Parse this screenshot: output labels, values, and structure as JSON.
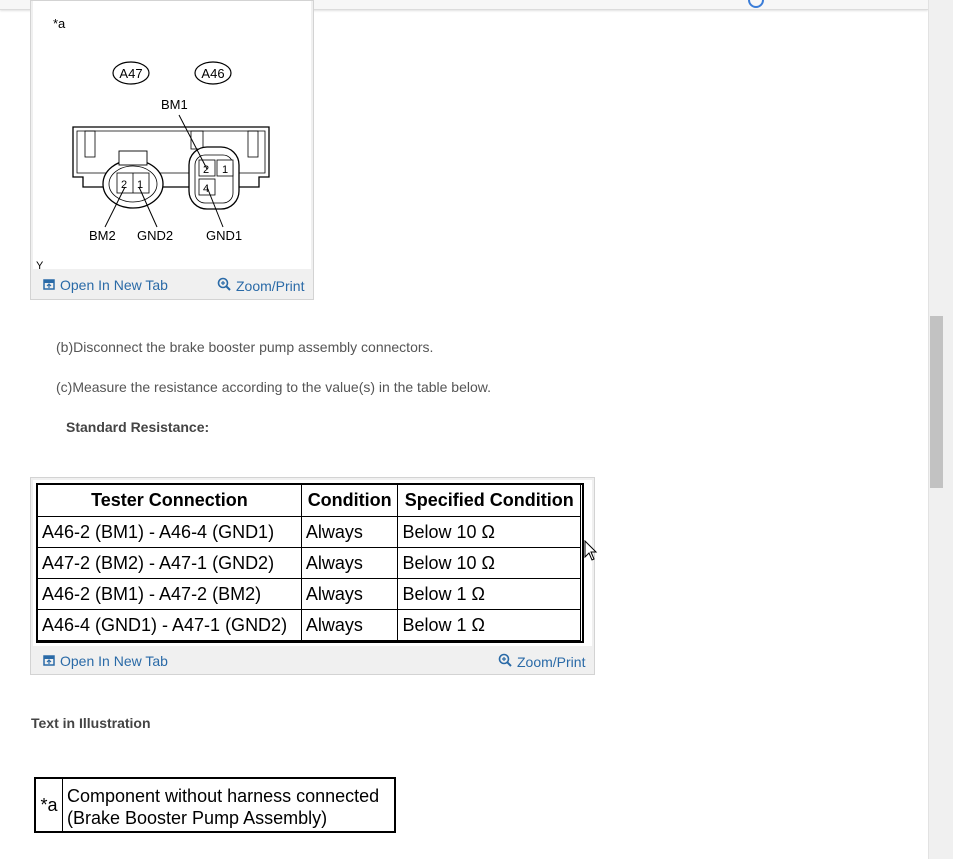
{
  "figure1": {
    "corner_label": "*a",
    "bottom_label": "Y",
    "connectors": {
      "left_id": "A47",
      "right_id": "A46",
      "bm1": "BM1",
      "bm2": "BM2",
      "gnd2": "GND2",
      "gnd1": "GND1",
      "pin_2_left": "2",
      "pin_1_left": "1",
      "pin_2_right": "2",
      "pin_1_right": "1",
      "pin_4_right": "4"
    },
    "open_tab": "Open In New Tab",
    "zoom": "Zoom/Print"
  },
  "steps": {
    "b": "(b)Disconnect the brake booster pump assembly connectors.",
    "c": "(c)Measure the resistance according to the value(s) in the table below.",
    "standard": "Standard Resistance:"
  },
  "table": {
    "headers": [
      "Tester Connection",
      "Condition",
      "Specified Condition"
    ],
    "rows": [
      [
        "A46-2 (BM1) - A46-4 (GND1)",
        "Always",
        "Below 10 Ω"
      ],
      [
        "A47-2 (BM2) - A47-1 (GND2)",
        "Always",
        "Below 10 Ω"
      ],
      [
        "A46-2 (BM1) - A47-2 (BM2)",
        "Always",
        "Below 1 Ω"
      ],
      [
        "A46-4 (GND1) - A47-1 (GND2)",
        "Always",
        "Below 1 Ω"
      ]
    ],
    "open_tab": "Open In New Tab",
    "zoom": "Zoom/Print"
  },
  "text_in_illustration": {
    "heading": "Text in Illustration",
    "key": "*a",
    "value_line1": "Component without harness connected",
    "value_line2": "(Brake Booster Pump Assembly)"
  }
}
